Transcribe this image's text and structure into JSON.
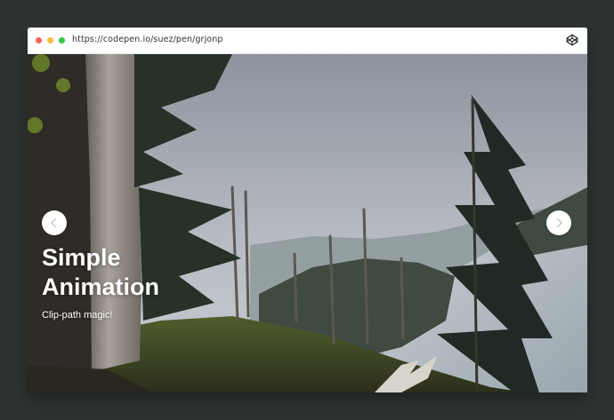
{
  "browser": {
    "url": "https://codepen.io/suez/pen/grjonp",
    "buttons": [
      "close",
      "minimize",
      "maximize"
    ],
    "icon": "codepen-icon"
  },
  "slider": {
    "title_line1": "Simple",
    "title_line2": "Animation",
    "subtitle": "Clip-path magic!",
    "prev_icon": "chevron-left-icon",
    "next_icon": "chevron-right-icon"
  },
  "colors": {
    "page_background": "#2f3433",
    "window_background": "#ffffff",
    "dot_red": "#fc605c",
    "dot_yellow": "#fdbc40",
    "dot_green": "#34c84a"
  }
}
